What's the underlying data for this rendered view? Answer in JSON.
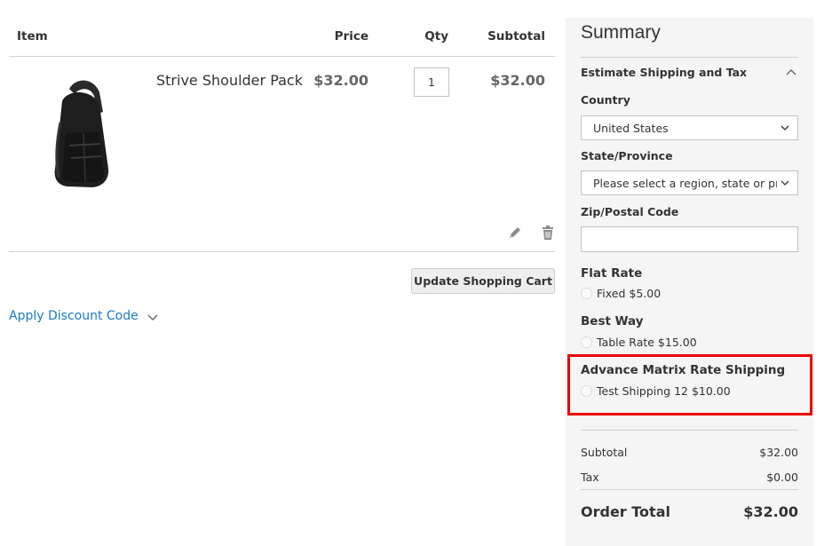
{
  "cart": {
    "headers": {
      "item": "Item",
      "price": "Price",
      "qty": "Qty",
      "subtotal": "Subtotal"
    },
    "items": [
      {
        "name": "Strive Shoulder Pack",
        "price": "$32.00",
        "qty": "1",
        "subtotal": "$32.00",
        "image": "black-shoulder-backpack"
      }
    ],
    "update_label": "Update Shopping Cart",
    "discount_label": "Apply Discount Code"
  },
  "summary": {
    "title": "Summary",
    "shipping_section": "Estimate Shipping and Tax",
    "country_label": "Country",
    "country_value": "United States",
    "state_label": "State/Province",
    "state_placeholder": "Please select a region, state or province.",
    "zip_label": "Zip/Postal Code",
    "zip_value": "",
    "methods": [
      {
        "title": "Flat Rate",
        "option": "Fixed $5.00"
      },
      {
        "title": "Best Way",
        "option": "Table Rate $15.00"
      },
      {
        "title": "Advance Matrix Rate Shipping",
        "option": "Test Shipping 12 $10.00"
      }
    ],
    "totals": {
      "subtotal_label": "Subtotal",
      "subtotal_value": "$32.00",
      "tax_label": "Tax",
      "tax_value": "$0.00",
      "order_total_label": "Order Total",
      "order_total_value": "$32.00"
    }
  },
  "colors": {
    "link": "#1979c3",
    "highlight": "#ec0000",
    "summary_bg": "#f5f5f5"
  },
  "icons": [
    "pencil-icon",
    "trash-icon",
    "chevron-down-icon",
    "chevron-up-icon"
  ]
}
